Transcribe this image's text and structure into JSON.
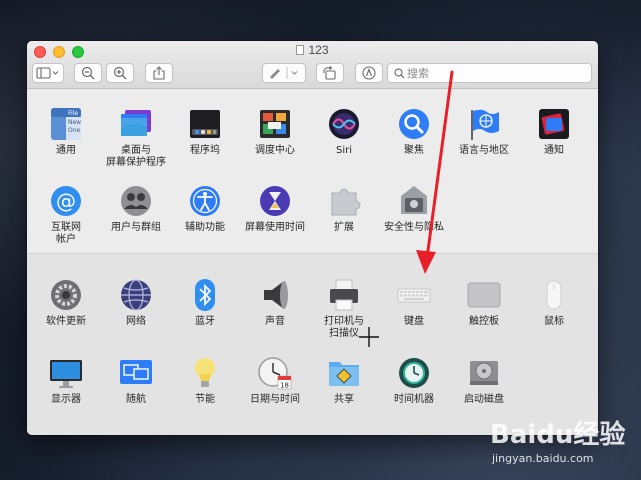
{
  "window": {
    "title": "123",
    "search_placeholder": "搜索"
  },
  "toolbar": {
    "buttons": [
      "sidebar-toggle",
      "zoom-out",
      "zoom-in",
      "share",
      "markup",
      "rotate",
      "annotate"
    ]
  },
  "panes_top": [
    {
      "label": "通用",
      "icon": "general-icon"
    },
    {
      "label": "桌面与\n屏幕保护程序",
      "icon": "desktop-icon"
    },
    {
      "label": "程序坞",
      "icon": "dock-icon"
    },
    {
      "label": "调度中心",
      "icon": "mission-control-icon"
    },
    {
      "label": "Siri",
      "icon": "siri-icon"
    },
    {
      "label": "聚焦",
      "icon": "spotlight-icon"
    },
    {
      "label": "语言与地区",
      "icon": "language-icon"
    },
    {
      "label": "通知",
      "icon": "notifications-icon"
    },
    {
      "label": "互联网\n帐户",
      "icon": "internet-accounts-icon"
    },
    {
      "label": "用户与群组",
      "icon": "users-icon"
    },
    {
      "label": "辅助功能",
      "icon": "accessibility-icon"
    },
    {
      "label": "屏幕使用时间",
      "icon": "screen-time-icon"
    },
    {
      "label": "扩展",
      "icon": "extensions-icon"
    },
    {
      "label": "安全性与隐私",
      "icon": "security-icon"
    }
  ],
  "panes_bottom": [
    {
      "label": "软件更新",
      "icon": "software-update-icon"
    },
    {
      "label": "网络",
      "icon": "network-icon"
    },
    {
      "label": "蓝牙",
      "icon": "bluetooth-icon"
    },
    {
      "label": "声音",
      "icon": "sound-icon"
    },
    {
      "label": "打印机与\n扫描仪",
      "icon": "printer-icon"
    },
    {
      "label": "键盘",
      "icon": "keyboard-icon"
    },
    {
      "label": "触控板",
      "icon": "trackpad-icon"
    },
    {
      "label": "鼠标",
      "icon": "mouse-icon"
    },
    {
      "label": "显示器",
      "icon": "displays-icon"
    },
    {
      "label": "随航",
      "icon": "sidecar-icon"
    },
    {
      "label": "节能",
      "icon": "energy-saver-icon"
    },
    {
      "label": "日期与时间",
      "icon": "date-time-icon"
    },
    {
      "label": "共享",
      "icon": "sharing-icon"
    },
    {
      "label": "时间机器",
      "icon": "time-machine-icon"
    },
    {
      "label": "启动磁盘",
      "icon": "startup-disk-icon"
    }
  ],
  "general_icon_text": [
    "File",
    "New",
    "One"
  ],
  "date_icon_text": "18",
  "watermark": {
    "logo": "Baidu经验",
    "url": "jingyan.baidu.com"
  },
  "colors": {
    "arrow": "#e8202a",
    "accent": "#2f7df6"
  }
}
